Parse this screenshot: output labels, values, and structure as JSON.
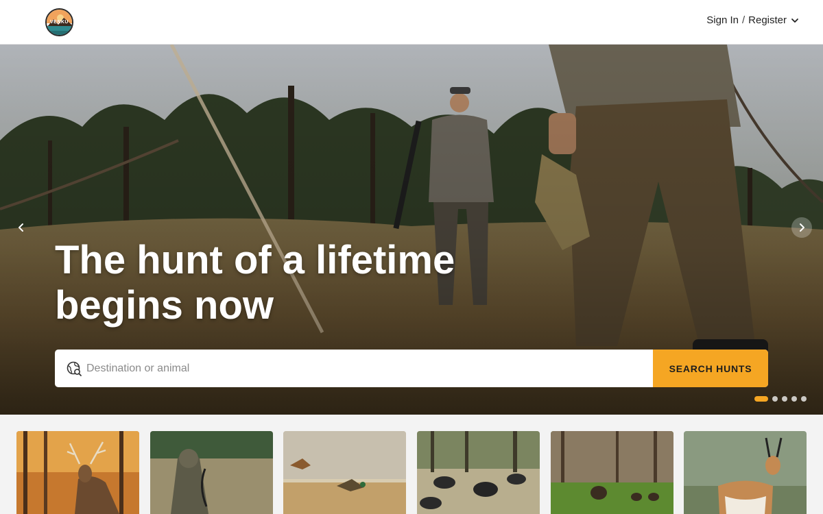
{
  "header": {
    "logo_text": "VENKU",
    "sign_in": "Sign In",
    "separator": "/",
    "register": "Register"
  },
  "hero": {
    "headline_line1": "The hunt of a lifetime",
    "headline_line2": "begins now",
    "search": {
      "placeholder": "Destination or animal",
      "value": "",
      "button_label": "SEARCH HUNTS"
    },
    "slides_total": 5,
    "active_slide": 1
  },
  "categories": [
    {
      "scene": "whitetail-deer-autumn-forest"
    },
    {
      "scene": "bow-hunter-camouflage-field"
    },
    {
      "scene": "ducks-flying-over-marsh"
    },
    {
      "scene": "wild-hogs-in-forest"
    },
    {
      "scene": "wild-turkeys-in-meadow"
    },
    {
      "scene": "pronghorn-antelope"
    }
  ],
  "colors": {
    "accent": "#f5a623",
    "header_bg": "#ffffff",
    "strip_bg": "#f3f3f3"
  }
}
